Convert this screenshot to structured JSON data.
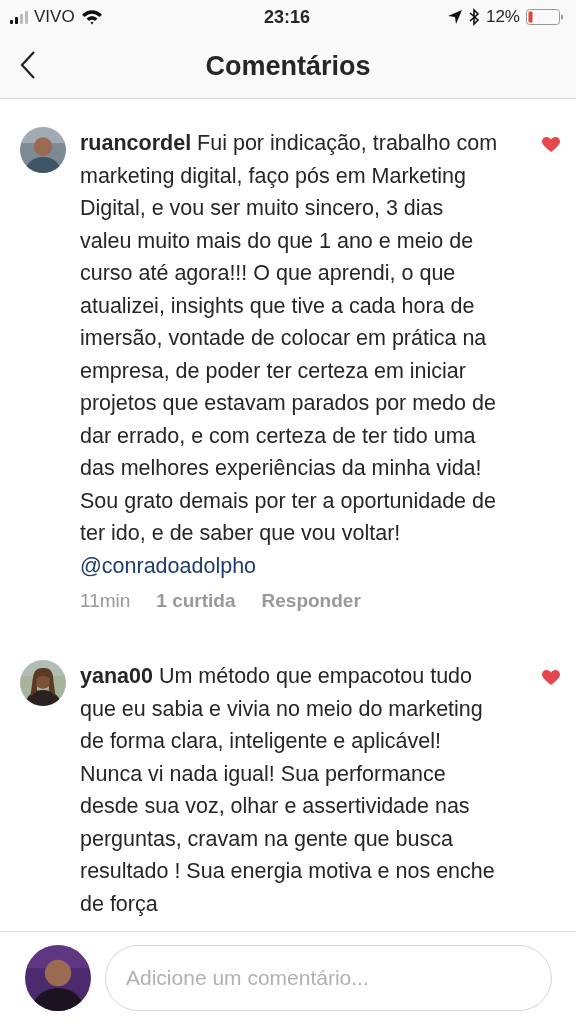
{
  "status_bar": {
    "carrier": "VIVO",
    "time": "23:16",
    "battery": "12%"
  },
  "header": {
    "title": "Comentários"
  },
  "comments": [
    {
      "username": "ruancordel",
      "text": "Fui por indicação, trabalho com marketing digital, faço pós em Marketing Digital, e vou ser muito sincero, 3 dias valeu muito mais do que 1 ano e meio de curso até agora!!! O que aprendi, o que atualizei, insights que tive a cada hora de imersão, vontade de colocar em prática na empresa, de poder ter certeza em iniciar projetos que estavam parados por medo de dar errado, e com certeza de ter tido uma das melhores experiências da minha vida! Sou grato demais por ter a oportunidade de ter ido, e de saber que vou voltar!",
      "mention": "@conradoadolpho",
      "liked": true,
      "time": "11min",
      "likes": "1 curtida",
      "reply": "Responder"
    },
    {
      "username": "yana00",
      "text": "Um método que empacotou tudo que eu sabia e vivia no meio do marketing de forma clara, inteligente e aplicável! Nunca vi nada igual! Sua performance desde sua voz, olhar e assertividade nas perguntas, cravam na gente que busca resultado ! Sua energia motiva e nos enche de força",
      "liked": true
    }
  ],
  "composer": {
    "placeholder": "Adicione um comentário..."
  }
}
